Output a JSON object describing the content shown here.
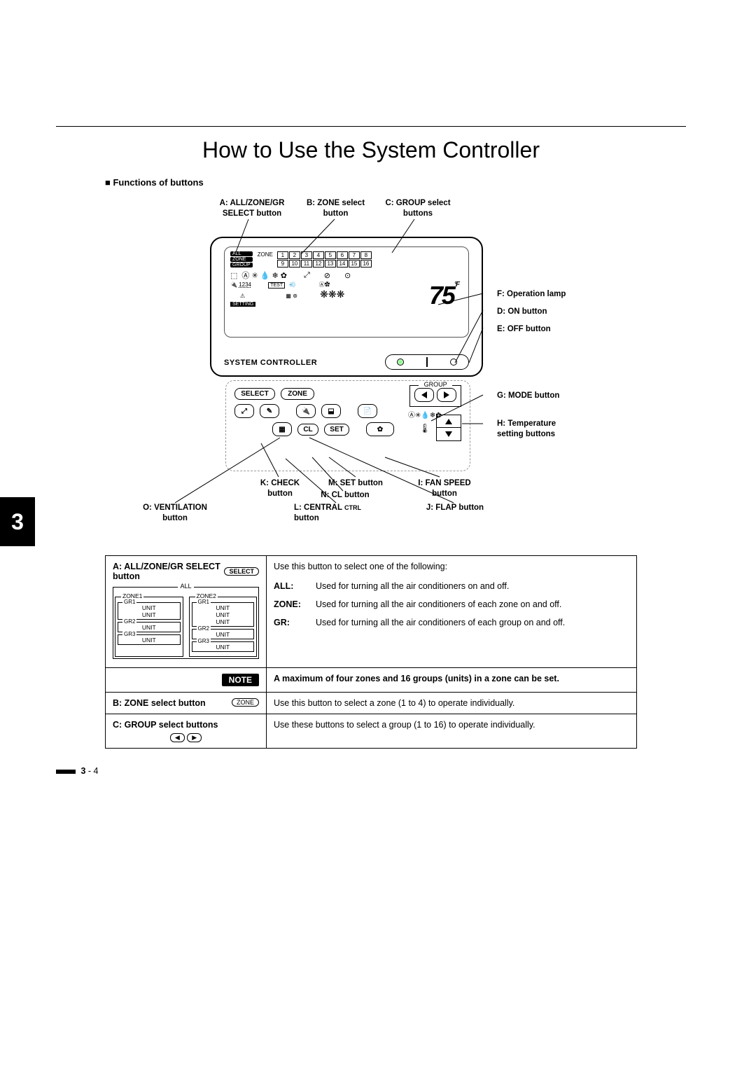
{
  "title": "How to Use the System Controller",
  "section_heading": "Functions of buttons",
  "chapter_number": "3",
  "page_footer": {
    "chapter": "3",
    "page": "4"
  },
  "callouts": {
    "A": "A: ALL/ZONE/GR SELECT button",
    "B": "B: ZONE select button",
    "C": "C: GROUP select buttons",
    "D": "D: ON button",
    "E": "E: OFF button",
    "F": "F:  Operation lamp",
    "G": "G: MODE button",
    "H": "H:  Temperature setting buttons",
    "I": "I: FAN SPEED button",
    "J": "J:  FLAP button",
    "K": "K: CHECK button",
    "L": "L:  CENTRAL ",
    "L_sub": "CTRL",
    "L_line2": "button",
    "M": "M: SET button",
    "N": "N: CL button",
    "O": "O: VENTILATION button"
  },
  "display": {
    "modes": [
      "ALL",
      "ZONE",
      "GROUP"
    ],
    "zone_label": "ZONE",
    "numbers_top": [
      "1",
      "2",
      "3",
      "4",
      "5",
      "6",
      "7",
      "8"
    ],
    "numbers_bot": [
      "9",
      "10",
      "11",
      "12",
      "13",
      "14",
      "15",
      "16"
    ],
    "icons_text": "Ⓐ ✳ 💧 ❄ ✿",
    "extra": "1234",
    "warn": "⚠",
    "test": "TEST",
    "setting": "SETTING",
    "temp": "75",
    "temp_unit": "°F",
    "sys_ctrl": "SYSTEM CONTROLLER"
  },
  "deck": {
    "select": "SELECT",
    "zone": "ZONE",
    "group": "GROUP",
    "cl": "CL",
    "set": "SET",
    "small_icons": "Ⓐ✳💧❄✿"
  },
  "table": {
    "rowA": {
      "title": "A:  ALL/ZONE/GR SELECT button",
      "btn_label": "SELECT",
      "intro": "Use this button to select one of the following:",
      "defs": [
        {
          "term": "ALL:",
          "desc": "Used for turning all the air conditioners on and off."
        },
        {
          "term": "ZONE:",
          "desc": "Used for turning all the air conditioners of each zone on and off."
        },
        {
          "term": "GR:",
          "desc": "Used for turning all the air conditioners of each group on and off."
        }
      ],
      "hierarchy": {
        "all": "ALL",
        "zones": [
          {
            "name": "ZONE1",
            "groups": [
              {
                "name": "GR1",
                "units": [
                  "UNIT",
                  "UNIT"
                ]
              },
              {
                "name": "GR2",
                "units": [
                  "UNIT"
                ]
              },
              {
                "name": "GR3",
                "units": [
                  "UNIT"
                ]
              }
            ]
          },
          {
            "name": "ZONE2",
            "groups": [
              {
                "name": "GR1",
                "units": [
                  "UNIT",
                  "UNIT",
                  "UNIT"
                ]
              },
              {
                "name": "GR2",
                "units": [
                  "UNIT"
                ]
              },
              {
                "name": "GR3",
                "units": [
                  "UNIT"
                ]
              }
            ]
          }
        ]
      }
    },
    "note": {
      "label": "NOTE",
      "text": "A maximum of four zones and 16 groups (units) in a zone can be set."
    },
    "rowB": {
      "title": "B: ZONE select button",
      "btn_label": "ZONE",
      "desc": "Use this button to select a zone (1 to 4) to operate individually."
    },
    "rowC": {
      "title": "C: GROUP select buttons",
      "desc": "Use these buttons to select a group (1 to 16) to operate individually."
    }
  }
}
